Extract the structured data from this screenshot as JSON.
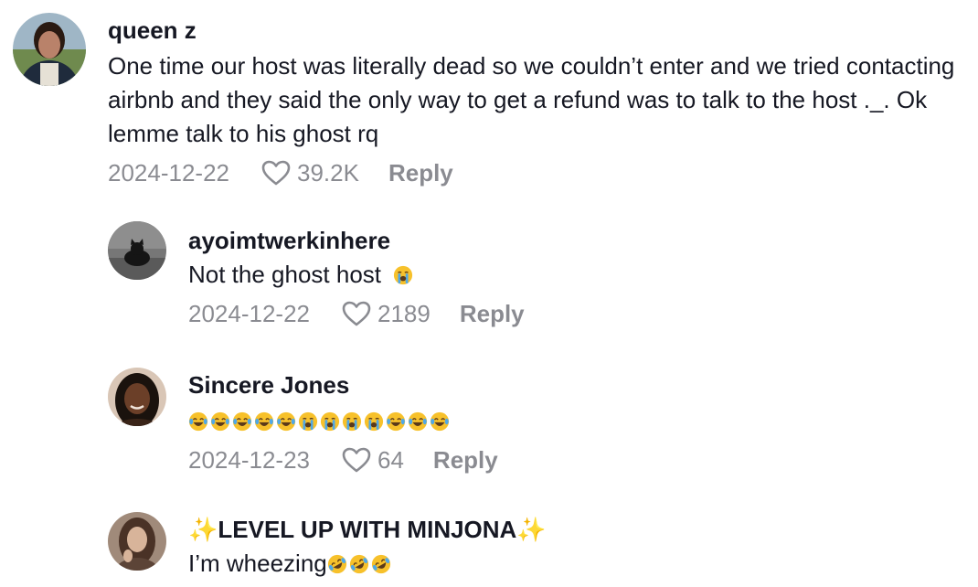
{
  "comments": [
    {
      "username": "queen z",
      "text": "One time our host was literally dead so we couldn’t enter and we tried contacting airbnb and they said the only way to get a refund was to talk to the host ._. Ok lemme talk to his ghost rq",
      "date": "2024-12-22",
      "likes": "39.2K",
      "reply_label": "Reply"
    },
    {
      "username": "ayoimtwerkinhere",
      "text": "Not the ghost host",
      "date": "2024-12-22",
      "likes": "2189",
      "reply_label": "Reply"
    },
    {
      "username": "Sincere Jones",
      "text": "😂😂😂😂😂😭😭😭😭😂😂😂",
      "date": "2024-12-23",
      "likes": "64",
      "reply_label": "Reply"
    },
    {
      "username": "✨LEVEL UP WITH MINJONA✨",
      "text": "I’m wheezing",
      "date": "",
      "likes": "",
      "reply_label": ""
    }
  ],
  "icons": {
    "like": "heart-outline-icon",
    "emoji_crying": "loudly-crying-face-emoji",
    "emoji_laughing": "tears-of-joy-emoji",
    "emoji_rofl": "rolling-on-floor-laughing-emoji",
    "sparkle": "sparkles-emoji"
  },
  "colors": {
    "text": "#161823",
    "muted": "#8a8b91",
    "emoji_yellow": "#f7c12b",
    "emoji_tear": "#4fa8e8"
  }
}
